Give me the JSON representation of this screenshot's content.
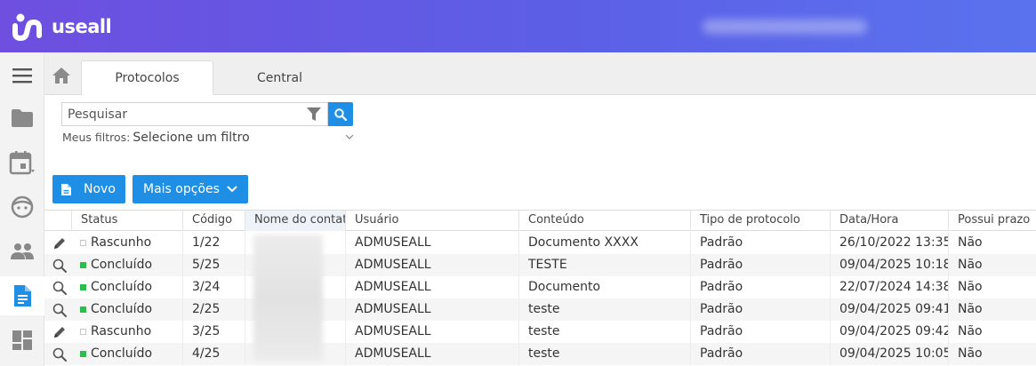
{
  "app": {
    "logo_text": "useall"
  },
  "tabs": [
    {
      "label": "Protocolos",
      "active": true
    },
    {
      "label": "Central",
      "active": false
    }
  ],
  "sidebar": {
    "items": [
      {
        "icon": "menu-icon"
      },
      {
        "icon": "folder-icon"
      },
      {
        "icon": "calendar-icon"
      },
      {
        "icon": "face-icon"
      },
      {
        "icon": "people-icon"
      },
      {
        "icon": "document-icon",
        "active": true
      },
      {
        "icon": "dashboard-icon"
      }
    ]
  },
  "search": {
    "placeholder": "Pesquisar"
  },
  "filters": {
    "label": "Meus filtros:",
    "value": "Selecione um filtro"
  },
  "toolbar": {
    "new_label": "Novo",
    "more_label": "Mais opções"
  },
  "colors": {
    "accent": "#1f8fe6",
    "header_start": "#6e4fe0",
    "header_end": "#5a72ee",
    "status_done": "#2ebd4d"
  },
  "table": {
    "columns": [
      "Status",
      "Código",
      "Nome do contato",
      "Usuário",
      "Conteúdo",
      "Tipo de protocolo",
      "Data/Hora",
      "Possui prazo"
    ],
    "rows": [
      {
        "action": "edit-icon",
        "status": "Rascunho",
        "status_type": "draft",
        "codigo": "1/22",
        "contato": "",
        "usuario": "ADMUSEALL",
        "conteudo": "Documento XXXX",
        "tipo": "Padrão",
        "data": "26/10/2022 13:35",
        "prazo": "Não"
      },
      {
        "action": "view-icon",
        "status": "Concluído",
        "status_type": "done",
        "codigo": "5/25",
        "contato": "",
        "usuario": "ADMUSEALL",
        "conteudo": "TESTE",
        "tipo": "Padrão",
        "data": "09/04/2025 10:18",
        "prazo": "Não"
      },
      {
        "action": "view-icon",
        "status": "Concluído",
        "status_type": "done",
        "codigo": "3/24",
        "contato": "",
        "usuario": "ADMUSEALL",
        "conteudo": "Documento",
        "tipo": "Padrão",
        "data": "22/07/2024 14:38",
        "prazo": "Não"
      },
      {
        "action": "view-icon",
        "status": "Concluído",
        "status_type": "done",
        "codigo": "2/25",
        "contato": "",
        "usuario": "ADMUSEALL",
        "conteudo": "teste",
        "tipo": "Padrão",
        "data": "09/04/2025 09:41",
        "prazo": "Não"
      },
      {
        "action": "edit-icon",
        "status": "Rascunho",
        "status_type": "draft",
        "codigo": "3/25",
        "contato": "",
        "usuario": "ADMUSEALL",
        "conteudo": "teste",
        "tipo": "Padrão",
        "data": "09/04/2025 09:42",
        "prazo": "Não"
      },
      {
        "action": "view-icon",
        "status": "Concluído",
        "status_type": "done",
        "codigo": "4/25",
        "contato": "",
        "usuario": "ADMUSEALL",
        "conteudo": "teste",
        "tipo": "Padrão",
        "data": "09/04/2025 10:05",
        "prazo": "Não"
      }
    ]
  }
}
